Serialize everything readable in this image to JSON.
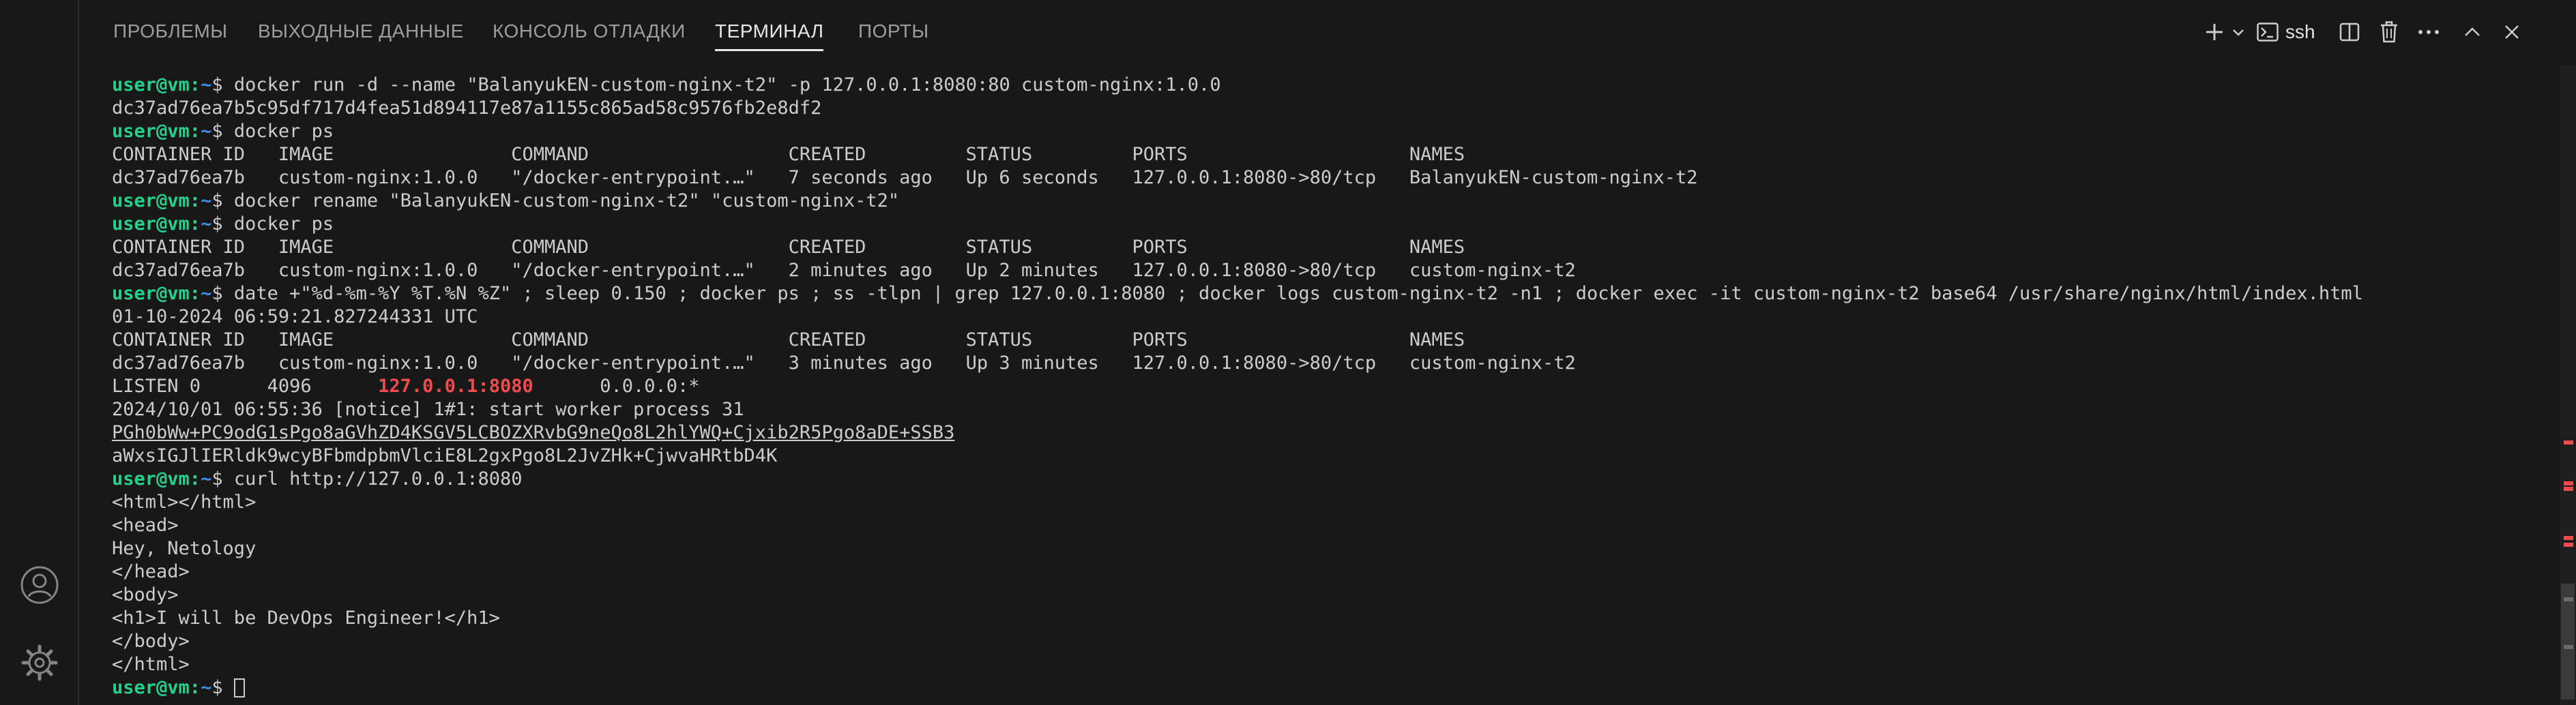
{
  "panel": {
    "tabs": [
      {
        "label": "ПРОБЛЕМЫ"
      },
      {
        "label": "ВЫХОДНЫЕ ДАННЫЕ"
      },
      {
        "label": "КОНСОЛЬ ОТЛАДКИ"
      },
      {
        "label": "ТЕРМИНАЛ",
        "active": true
      },
      {
        "label": "ПОРТЫ"
      }
    ],
    "terminal_name": "ssh"
  },
  "terminal": {
    "user": "user@vm",
    "path": "~",
    "lines": {
      "l1": "docker run -d --name \"BalanyukEN-custom-nginx-t2\" -p 127.0.0.1:8080:80 custom-nginx:1.0.0",
      "l2": "dc37ad76ea7b5c95df717d4fea51d894117e87a1155c865ad58c9576fb2e8df2",
      "l3": "docker ps",
      "l4": "CONTAINER ID   IMAGE                COMMAND                  CREATED         STATUS         PORTS                    NAMES",
      "l5": "dc37ad76ea7b   custom-nginx:1.0.0   \"/docker-entrypoint.…\"   7 seconds ago   Up 6 seconds   127.0.0.1:8080->80/tcp   BalanyukEN-custom-nginx-t2",
      "l6": "docker rename \"BalanyukEN-custom-nginx-t2\" \"custom-nginx-t2\"",
      "l7": "docker ps",
      "l8": "CONTAINER ID   IMAGE                COMMAND                  CREATED         STATUS         PORTS                    NAMES",
      "l9": "dc37ad76ea7b   custom-nginx:1.0.0   \"/docker-entrypoint.…\"   2 minutes ago   Up 2 minutes   127.0.0.1:8080->80/tcp   custom-nginx-t2",
      "l10": "date +\"%d-%m-%Y %T.%N %Z\" ; sleep 0.150 ; docker ps ; ss -tlpn | grep 127.0.0.1:8080 ; docker logs custom-nginx-t2 -n1 ; docker exec -it custom-nginx-t2 base64 /usr/share/nginx/html/index.html",
      "l11": "01-10-2024 06:59:21.827244331 UTC",
      "l12": "CONTAINER ID   IMAGE                COMMAND                  CREATED         STATUS         PORTS                    NAMES",
      "l13": "dc37ad76ea7b   custom-nginx:1.0.0   \"/docker-entrypoint.…\"   3 minutes ago   Up 3 minutes   127.0.0.1:8080->80/tcp   custom-nginx-t2",
      "l14a": "LISTEN 0      4096      ",
      "l14b": "127.0.0.1:8080",
      "l14c": "      0.0.0.0:*",
      "l15": "2024/10/01 06:55:36 [notice] 1#1: start worker process 31",
      "l16": "PGh0bWw+PC9odG1sPgo8aGVhZD4KSGV5LCBOZXRvbG9neQo8L2hlYWQ+Cjxib2R5Pgo8aDE+SSB3",
      "l17": "aWxsIGJlIERldk9wcyBFbmdpbmVlciE8L2gxPgo8L2JvZHk+CjwvaHRtbD4K",
      "l18": "curl http://127.0.0.1:8080",
      "l19": "<html></html>",
      "l20": "<head>",
      "l21": "Hey, Netology",
      "l22": "</head>",
      "l23": "<body>",
      "l24": "<h1>I will be DevOps Engineer!</h1>",
      "l25": "</body>",
      "l26": "</html>"
    }
  },
  "icons": {
    "accounts": "account-icon",
    "settings": "gear-icon",
    "new_terminal": "plus-icon",
    "launch_profile": "chevron-down-icon",
    "terminal": "terminal-icon",
    "split": "split-terminal-icon",
    "kill": "trash-icon",
    "more": "more-actions-icon",
    "maximize": "chevron-up-icon",
    "close": "close-icon"
  },
  "colors": {
    "background": "#181818",
    "prompt_user": "#23d18b",
    "prompt_path": "#3b8eea",
    "highlight": "#f14c4c",
    "text": "#cccccc"
  }
}
